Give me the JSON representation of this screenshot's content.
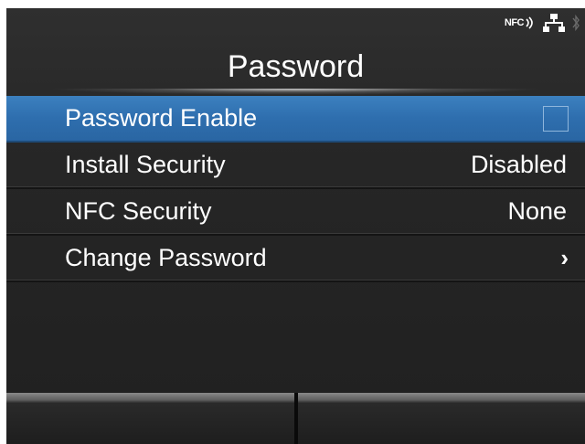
{
  "status_bar": {
    "nfc_label": "NFC",
    "icons": [
      "nfc-icon",
      "network-icon",
      "bluetooth-icon"
    ]
  },
  "title": "Password",
  "menu": {
    "items": [
      {
        "label": "Password Enable",
        "value": "",
        "control": "checkbox",
        "checked": false,
        "selected": true
      },
      {
        "label": "Install Security",
        "value": "Disabled",
        "control": "value",
        "selected": false
      },
      {
        "label": "NFC Security",
        "value": "None",
        "control": "value",
        "selected": false
      },
      {
        "label": "Change Password",
        "value": "",
        "control": "chevron-right-icon",
        "selected": false
      }
    ]
  },
  "soft_keys": [
    "",
    ""
  ],
  "colors": {
    "background": "#262626",
    "selected_row": "#2e6eae",
    "text": "#ffffff"
  }
}
